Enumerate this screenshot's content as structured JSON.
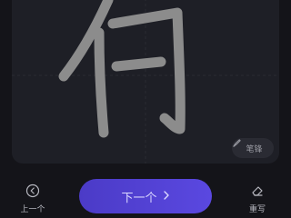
{
  "canvas": {
    "brush_label": "笔锋"
  },
  "toolbar": {
    "prev_label": "上一个",
    "next_label": "下一个",
    "rewrite_label": "重写"
  },
  "icons": {
    "brush": "brush-icon",
    "prev": "circle-chevron-left-icon",
    "next": "chevron-right-icon",
    "rewrite": "eraser-icon"
  },
  "colors": {
    "background": "#141419",
    "panel": "#1e1f26",
    "stroke": "#8c8c8c",
    "accent": "#5a48e0"
  }
}
